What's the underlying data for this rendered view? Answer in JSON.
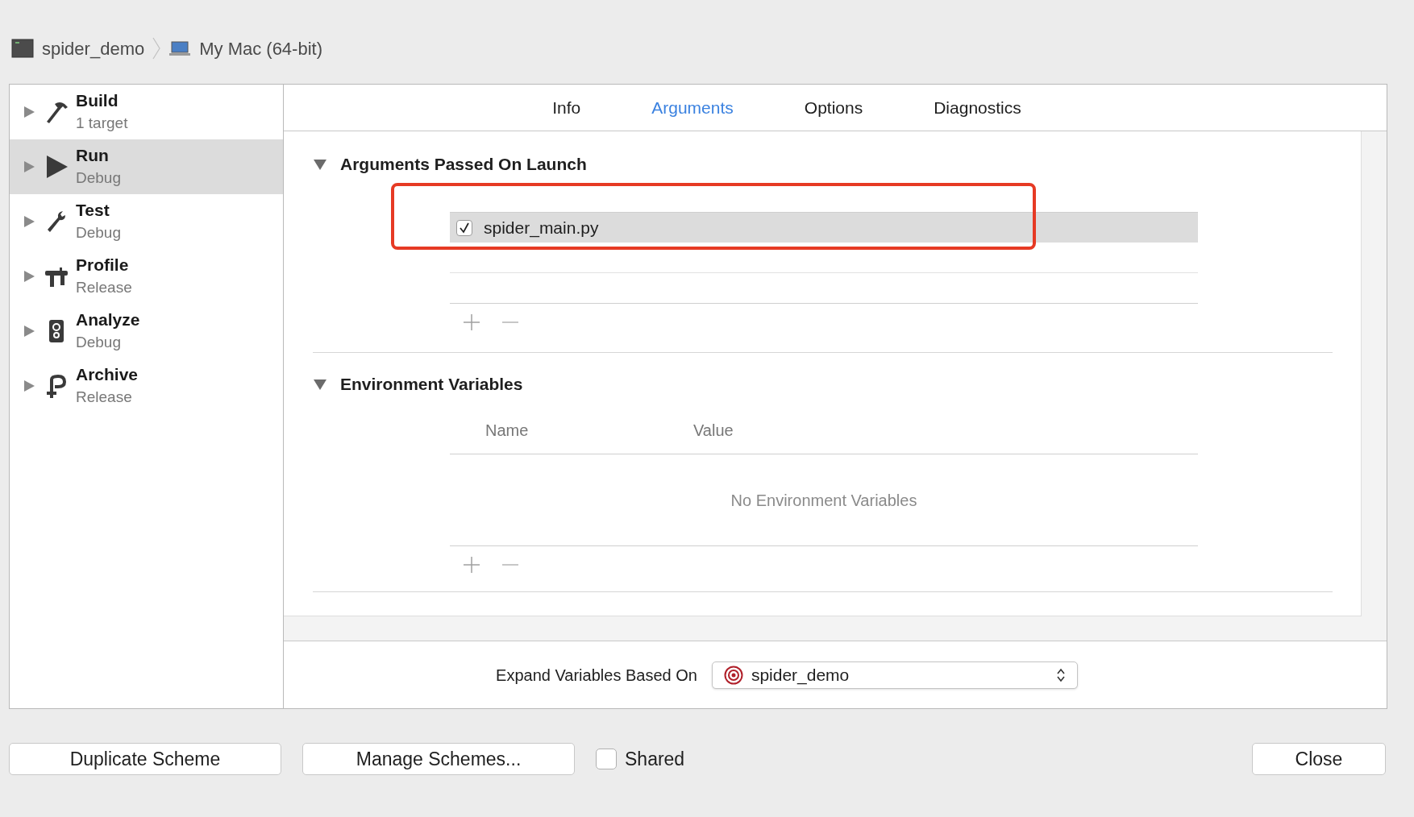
{
  "breadcrumb": {
    "scheme": "spider_demo",
    "destination": "My Mac (64-bit)"
  },
  "sidebar": {
    "items": [
      {
        "kind": "build",
        "title": "Build",
        "subtitle": "1 target",
        "selected": false
      },
      {
        "kind": "run",
        "title": "Run",
        "subtitle": "Debug",
        "selected": true
      },
      {
        "kind": "test",
        "title": "Test",
        "subtitle": "Debug",
        "selected": false
      },
      {
        "kind": "profile",
        "title": "Profile",
        "subtitle": "Release",
        "selected": false
      },
      {
        "kind": "analyze",
        "title": "Analyze",
        "subtitle": "Debug",
        "selected": false
      },
      {
        "kind": "archive",
        "title": "Archive",
        "subtitle": "Release",
        "selected": false
      }
    ]
  },
  "tabs": [
    {
      "label": "Info",
      "selected": false
    },
    {
      "label": "Arguments",
      "selected": true
    },
    {
      "label": "Options",
      "selected": false
    },
    {
      "label": "Diagnostics",
      "selected": false
    }
  ],
  "arguments_section": {
    "title": "Arguments Passed On Launch",
    "expanded": true,
    "arguments": [
      {
        "text": "spider_main.py",
        "checked": true,
        "selected": true
      }
    ]
  },
  "environment_section": {
    "title": "Environment Variables",
    "expanded": true,
    "columns": [
      "Name",
      "Value"
    ],
    "empty_text": "No Environment Variables"
  },
  "expand_variables": {
    "label": "Expand Variables Based On",
    "value": "spider_demo"
  },
  "buttons": {
    "duplicate": "Duplicate Scheme",
    "manage": "Manage Schemes...",
    "close": "Close"
  },
  "shared": {
    "label": "Shared",
    "checked": false
  }
}
